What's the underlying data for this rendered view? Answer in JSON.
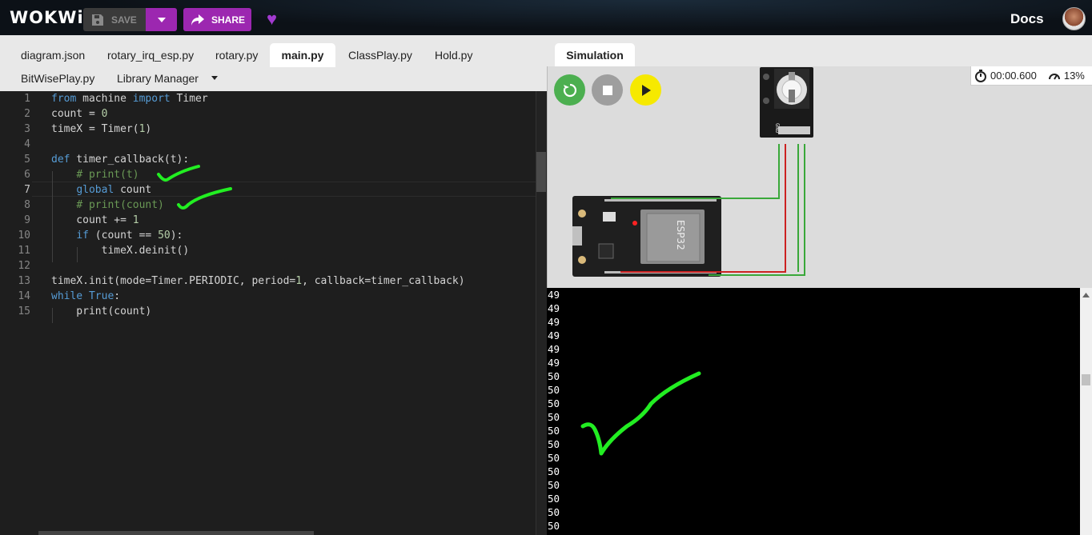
{
  "header": {
    "logo": "WOKWi",
    "save_label": "SAVE",
    "share_label": "SHARE",
    "docs_label": "Docs"
  },
  "editor": {
    "tabs": [
      "diagram.json",
      "rotary_irq_esp.py",
      "rotary.py",
      "main.py",
      "ClassPlay.py",
      "Hold.py",
      "BitWisePlay.py",
      "Library Manager"
    ],
    "active_tab": "main.py",
    "current_line": 7,
    "lines": [
      "from machine import Timer",
      "count = 0",
      "timeX = Timer(1)",
      "",
      "def timer_callback(t):",
      "    # print(t)",
      "    global count",
      "    # print(count)",
      "    count += 1",
      "    if (count == 50):",
      "        timeX.deinit()",
      "",
      "timeX.init(mode=Timer.PERIODIC, period=1, callback=timer_callback)",
      "while True:",
      "    print(count)"
    ]
  },
  "simulation": {
    "tab_label": "Simulation",
    "timer": "00:00.600",
    "speed": "13%",
    "controls": [
      "restart",
      "stop",
      "play"
    ],
    "esp32_label": "ESP32",
    "encoder_pins": [
      "GND",
      "+",
      "SW",
      "DT",
      "CLK"
    ],
    "serial_output": [
      "49",
      "49",
      "49",
      "49",
      "49",
      "49",
      "50",
      "50",
      "50",
      "50",
      "50",
      "50",
      "50",
      "50",
      "50",
      "50",
      "50",
      "50"
    ]
  },
  "colors": {
    "brand_purple": "#9c27b0",
    "restart_green": "#4caf50",
    "play_yellow": "#f6e900",
    "annotation_green": "#22ee22"
  }
}
